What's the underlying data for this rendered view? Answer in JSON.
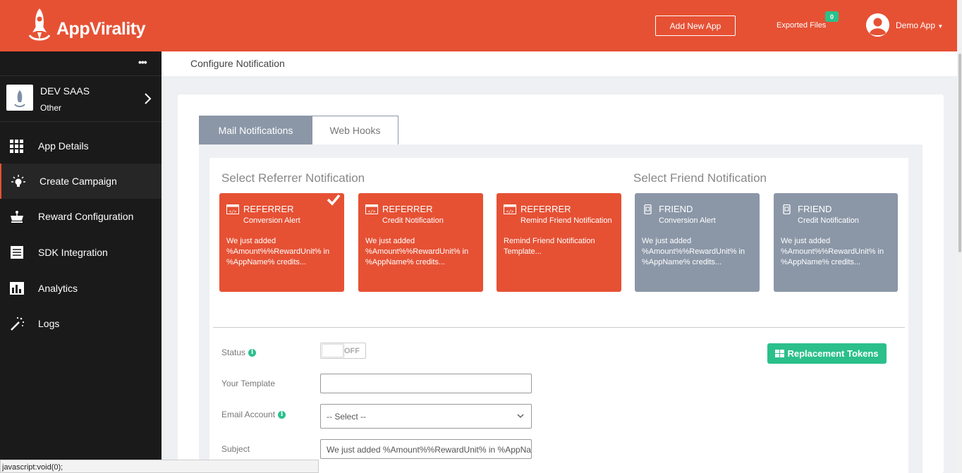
{
  "header": {
    "brand": "AppVirality",
    "add_app_label": "Add New App",
    "exported_label": "Exported Files",
    "exported_count": "0",
    "user_label": "Demo App"
  },
  "sidebar": {
    "app": {
      "name": "DEV SAAS",
      "type": "Other"
    },
    "items": [
      {
        "label": "App Details",
        "icon": "grid-icon"
      },
      {
        "label": "Create Campaign",
        "icon": "bulb-icon"
      },
      {
        "label": "Reward Configuration",
        "icon": "crown-icon"
      },
      {
        "label": "SDK Integration",
        "icon": "document-icon"
      },
      {
        "label": "Analytics",
        "icon": "bar-chart-icon"
      },
      {
        "label": "Logs",
        "icon": "wand-icon"
      }
    ]
  },
  "breadcrumb": "Configure Notification",
  "tabs": [
    {
      "label": "Mail Notifications"
    },
    {
      "label": "Web Hooks"
    }
  ],
  "sections": {
    "referrer_title": "Select Referrer Notification",
    "friend_title": "Select Friend Notification"
  },
  "cards": [
    {
      "title": "REFERRER",
      "subtitle": "Conversion Alert",
      "description": "We just added %Amount%%RewardUnit% in %AppName% credits...",
      "selected": true
    },
    {
      "title": "REFERRER",
      "subtitle": "Credit Notification",
      "description": "We just added %Amount%%RewardUnit% in %AppName% credits..."
    },
    {
      "title": "REFERRER",
      "subtitle": "Remind Friend Notification",
      "description": "Remind Friend Notification Template..."
    },
    {
      "title": "FRIEND",
      "subtitle": "Conversion Alert",
      "description": "We just added %Amount%%RewardUnit% in %AppName% credits..."
    },
    {
      "title": "FRIEND",
      "subtitle": "Credit Notification",
      "description": "We just added %Amount%%RewardUnit% in %AppName% credits..."
    }
  ],
  "form": {
    "status_label": "Status",
    "status_value": "OFF",
    "template_label": "Your Template",
    "template_value": "",
    "email_label": "Email Account",
    "email_value": "-- Select --",
    "subject_label": "Subject",
    "subject_value": "We just added %Amount%%RewardUnit% in %AppNar",
    "tokens_label": "Replacement Tokens"
  },
  "statusbar": "javascript:void(0);",
  "colors": {
    "brand": "#e65134",
    "accent": "#2bc08b",
    "friend_card": "#8b97a7"
  }
}
